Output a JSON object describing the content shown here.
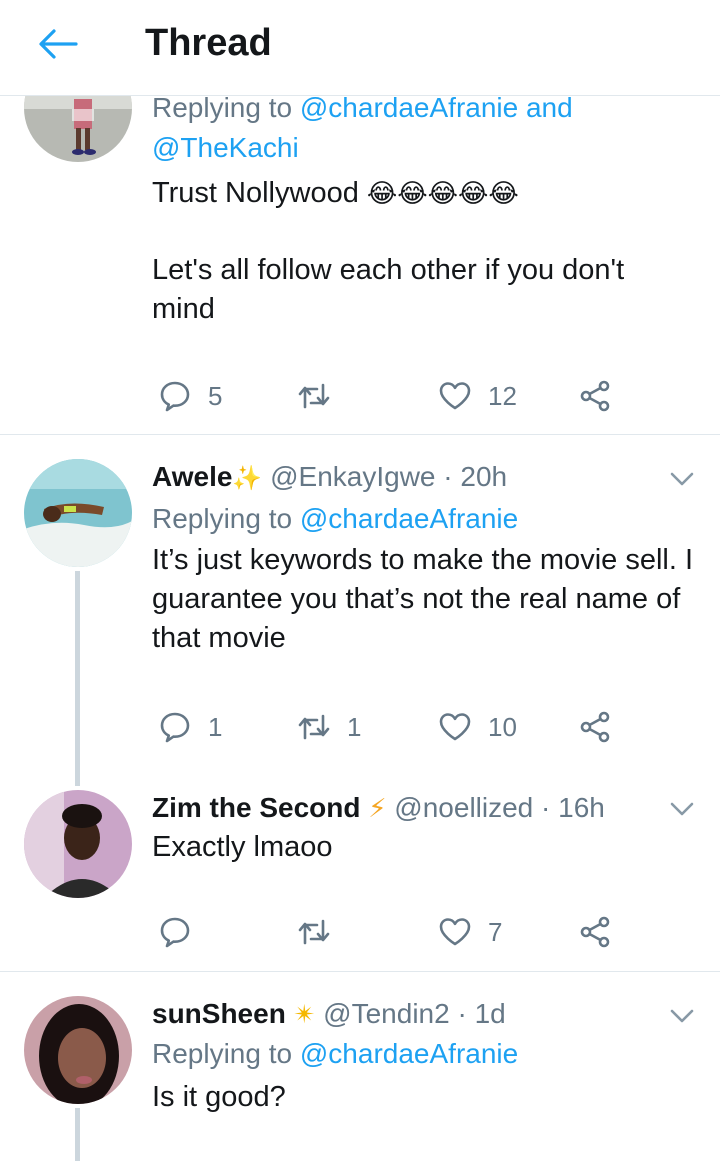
{
  "header": {
    "title": "Thread"
  },
  "tweet1": {
    "replying_prefix": "Replying to",
    "replying_to_1": "@chardaeAfranie",
    "replying_and": "and",
    "replying_to_2": "@TheKachi",
    "text_line1": "Trust Nollywood",
    "emoji": "😂😂😂😂😂",
    "text_line2": "Let's all follow each other if you don't mind",
    "reply_count": "5",
    "retweet_count": "",
    "like_count": "12"
  },
  "tweet2": {
    "name": "Awele",
    "name_emoji": "✨",
    "handle": "@EnkayIgwe",
    "time": "20h",
    "replying_prefix": "Replying to",
    "replying_to": "@chardaeAfranie",
    "text": "It’s just keywords to make the movie sell. I guarantee you that’s not the real name of that movie",
    "reply_count": "1",
    "retweet_count": "1",
    "like_count": "10"
  },
  "tweet3": {
    "name": "Zim the Second",
    "name_emoji": "⚡",
    "handle": "@noellized",
    "time": "16h",
    "text": "Exactly lmaoo",
    "reply_count": "",
    "retweet_count": "",
    "like_count": "7"
  },
  "tweet4": {
    "name": "sunSheen",
    "name_emoji": "✴",
    "handle": "@Tendin2",
    "time": "1d",
    "replying_prefix": "Replying to",
    "replying_to": "@chardaeAfranie",
    "text": "Is it good?"
  },
  "separator": "·",
  "colors": {
    "accent": "#1da1f2",
    "secondary_text": "#657786",
    "divider": "#e1e8ed",
    "thread_line": "#ccd6dd"
  },
  "icons": [
    "back-arrow-icon",
    "reply-icon",
    "retweet-icon",
    "like-icon",
    "share-icon",
    "chevron-down-icon"
  ]
}
